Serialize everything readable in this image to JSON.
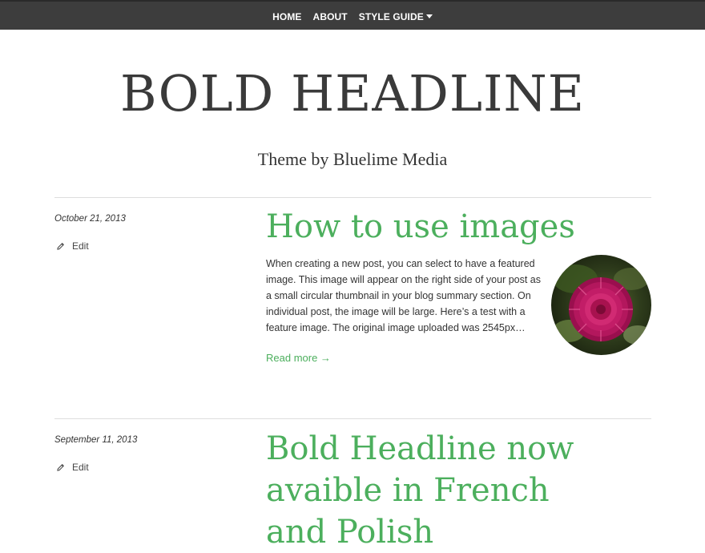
{
  "nav": {
    "items": [
      "HOME",
      "ABOUT",
      "STYLE GUIDE"
    ]
  },
  "site": {
    "title": "BOLD HEADLINE",
    "description": "Theme by Bluelime Media"
  },
  "posts": [
    {
      "date": "October 21, 2013",
      "edit_label": "Edit",
      "title": "How to use images",
      "excerpt": "When creating a new post, you can select to have a featured image. This image will appear on the right side of your post as a small circular thumbnail in your blog summary section. On individual post, the image will be large. Here’s a test with a feature image. The original image uploaded was 2545px…",
      "read_more": "Read more →"
    },
    {
      "date": "September 11, 2013",
      "edit_label": "Edit",
      "title": "Bold Headline now avaible in French and Polish"
    }
  ],
  "colors": {
    "nav_bg": "#3d3d3d",
    "accent_green": "#4caf5d",
    "text": "#333333"
  },
  "icons": {
    "edit": "pencil-icon",
    "dropdown": "chevron-down-icon"
  }
}
